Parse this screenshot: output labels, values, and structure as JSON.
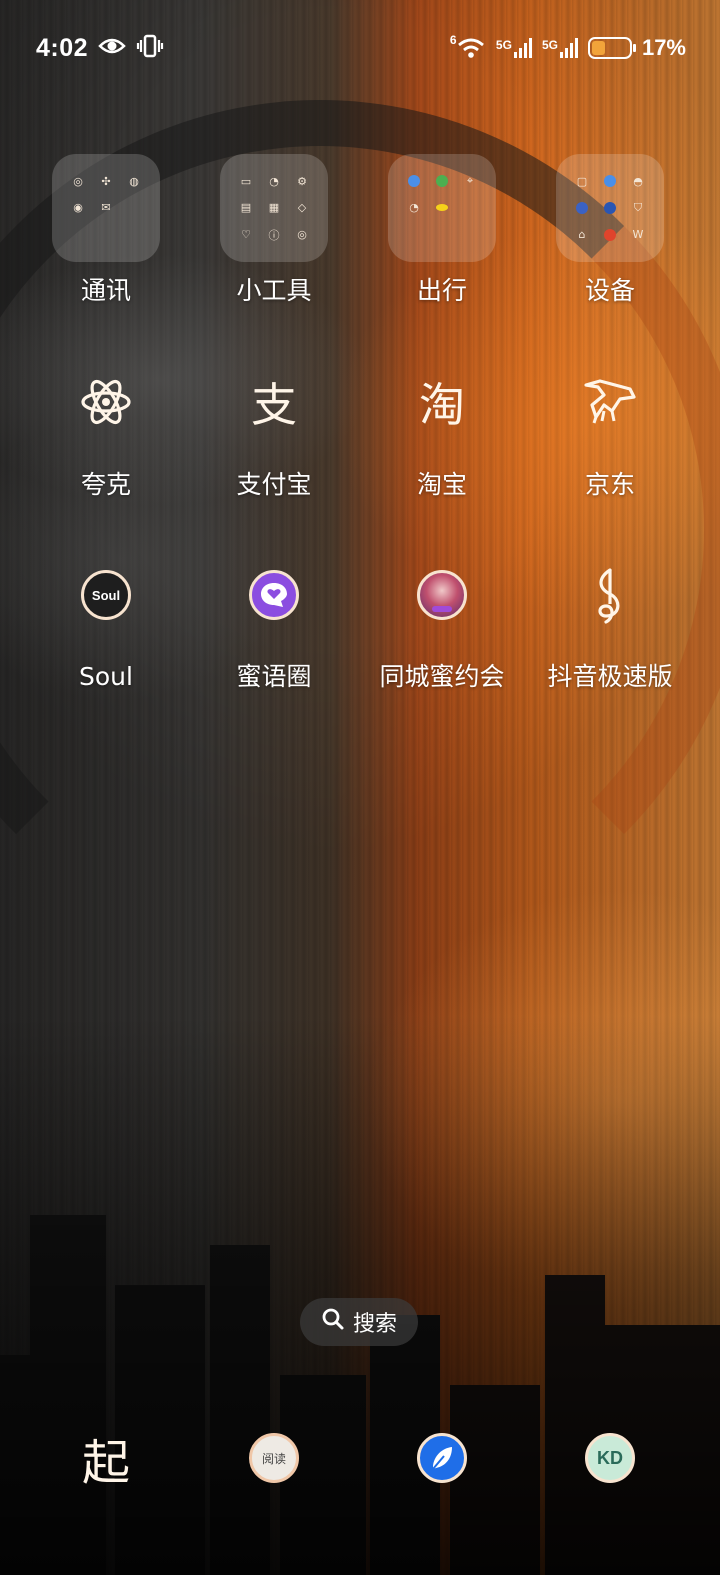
{
  "status_bar": {
    "time": "4:02",
    "icons": [
      "eye-icon",
      "vibrate-icon",
      "wifi-icon",
      "signal-icon",
      "signal-icon",
      "battery-icon"
    ],
    "wifi_label": "6",
    "sim1_label": "5G",
    "sim2_label": "5G",
    "battery_level": 0.17,
    "battery_text": "17%"
  },
  "folders": [
    {
      "label": "通讯",
      "mini_icons": [
        "phone-icon",
        "grid-icon",
        "message-icon",
        "clock-icon",
        "mail-icon"
      ]
    },
    {
      "label": "小工具",
      "mini_icons": [
        "folder-icon",
        "compass-icon",
        "settings-icon",
        "doc-icon",
        "calc-icon",
        "eye-icon",
        "diamond-icon",
        "info-icon",
        "wind-icon"
      ]
    },
    {
      "label": "出行",
      "mini_icons": [
        "map-icon",
        "car-icon",
        "pin-icon",
        "clock-icon",
        "bike-icon"
      ]
    },
    {
      "label": "设备",
      "mini_icons": [
        "phone-icon",
        "app-icon",
        "mic-icon",
        "facebook-icon",
        "globe-icon",
        "shield-icon",
        "lock-icon",
        "circle-icon",
        "text-icon"
      ]
    }
  ],
  "apps_row2": [
    {
      "label": "夸克",
      "icon": "atom-icon"
    },
    {
      "label": "支付宝",
      "icon": "alipay-icon",
      "glyph": "支"
    },
    {
      "label": "淘宝",
      "icon": "taobao-icon",
      "glyph": "淘"
    },
    {
      "label": "京东",
      "icon": "jd-dog-icon"
    }
  ],
  "apps_row3": [
    {
      "label": "Soul",
      "icon": "soul-icon",
      "badge": "Soul"
    },
    {
      "label": "蜜语圈",
      "icon": "chat-heart-icon"
    },
    {
      "label": "同城蜜约会",
      "icon": "portrait-icon"
    },
    {
      "label": "抖音极速版",
      "icon": "music-note-icon"
    }
  ],
  "search": {
    "label": "搜索"
  },
  "dock": [
    {
      "icon": "qidian-icon",
      "glyph": "起"
    },
    {
      "icon": "reader-icon",
      "glyph": "阅读"
    },
    {
      "icon": "feather-icon"
    },
    {
      "icon": "kd-icon",
      "glyph": "KD"
    }
  ],
  "colors": {
    "accent_orange": "#d2681f",
    "icon_outline": "#f7e3cf",
    "battery_fill": "#f2a43a"
  }
}
